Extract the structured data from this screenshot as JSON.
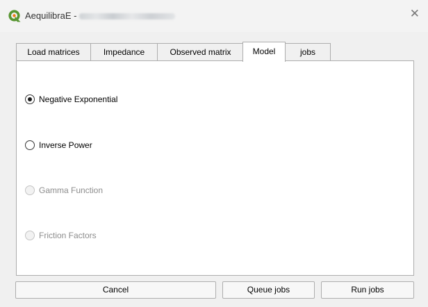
{
  "window": {
    "title": "AequilibraE -",
    "app_icon": "qgis-logo-icon",
    "close_icon": "close-icon"
  },
  "tabs": [
    {
      "label": "Load matrices",
      "active": false
    },
    {
      "label": "Impedance",
      "active": false
    },
    {
      "label": "Observed matrix",
      "active": false
    },
    {
      "label": "Model",
      "active": true
    },
    {
      "label": "jobs",
      "active": false
    }
  ],
  "model": {
    "options": [
      {
        "label": "Negative Exponential",
        "checked": true,
        "enabled": true
      },
      {
        "label": "Inverse Power",
        "checked": false,
        "enabled": true
      },
      {
        "label": "Gamma Function",
        "checked": false,
        "enabled": false
      },
      {
        "label": "Friction Factors",
        "checked": false,
        "enabled": false
      }
    ]
  },
  "buttons": {
    "cancel": "Cancel",
    "queue": "Queue jobs",
    "run": "Run jobs"
  },
  "colors": {
    "window_bg": "#f0f0f0",
    "panel_bg": "#ffffff",
    "border": "#adadad",
    "disabled_text": "#8c8c8c",
    "qgis_green": "#589632"
  }
}
